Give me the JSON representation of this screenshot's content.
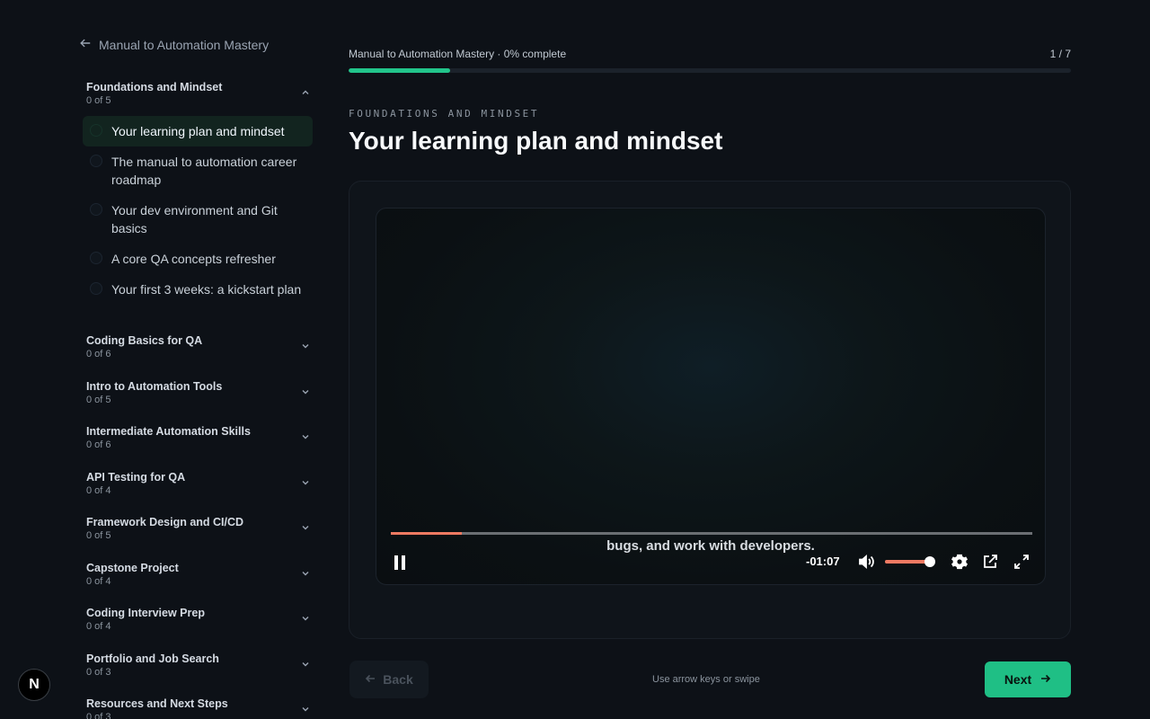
{
  "sidebar": {
    "back_label": "Manual to Automation Mastery",
    "modules": [
      {
        "title": "Foundations and Mindset",
        "count": "0 of 5",
        "expanded": true
      },
      {
        "title": "Coding Basics for QA",
        "count": "0 of 6"
      },
      {
        "title": "Intro to Automation Tools",
        "count": "0 of 5"
      },
      {
        "title": "Intermediate Automation Skills",
        "count": "0 of 6"
      },
      {
        "title": "API Testing for QA",
        "count": "0 of 4"
      },
      {
        "title": "Framework Design and CI/CD",
        "count": "0 of 5"
      },
      {
        "title": "Capstone Project",
        "count": "0 of 4"
      },
      {
        "title": "Coding Interview Prep",
        "count": "0 of 4"
      },
      {
        "title": "Portfolio and Job Search",
        "count": "0 of 3"
      },
      {
        "title": "Resources and Next Steps",
        "count": "0 of 3"
      }
    ],
    "lessons": [
      {
        "label": "Your learning plan and mindset",
        "active": true
      },
      {
        "label": "The manual to automation career roadmap"
      },
      {
        "label": "Your dev environment and Git basics"
      },
      {
        "label": "A core QA concepts refresher"
      },
      {
        "label": "Your first 3 weeks: a kickstart plan"
      }
    ]
  },
  "header": {
    "progress_text": "Manual to Automation Mastery · 0% complete",
    "step": "1 / 7",
    "step_progress": 0.14
  },
  "lesson": {
    "eyebrow": "FOUNDATIONS AND MINDSET",
    "title": "Your learning plan and mindset"
  },
  "player": {
    "caption": "bugs, and work with developers.",
    "time_remaining": "-01:07",
    "playback_progress": 0.11,
    "volume": 0.9,
    "accent": "#f07a62"
  },
  "footer": {
    "back_label": "Back",
    "hint": "Use arrow keys or swipe",
    "next_label": "Next"
  },
  "badge": {
    "letter": "N"
  },
  "colors": {
    "accent": "#1fbf85",
    "progress": "#22c58b"
  }
}
